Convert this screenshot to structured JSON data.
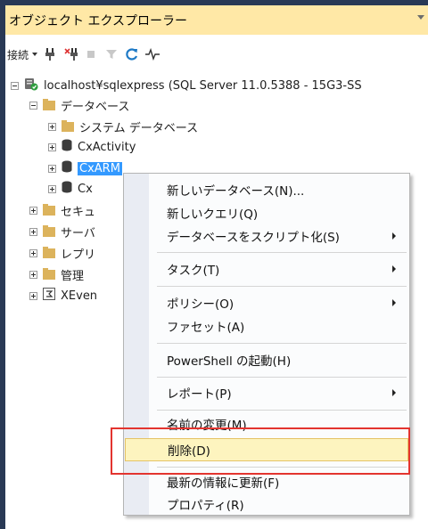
{
  "window": {
    "title": "オブジェクト エクスプローラー"
  },
  "toolbar": {
    "connect_label": "接続"
  },
  "tree": {
    "server": "localhost¥sqlexpress (SQL Server 11.0.5388 - 15G3-SS",
    "databases": "データベース",
    "system_databases": "システム データベース",
    "db1": "CxActivity",
    "db2_selected": "CxARM",
    "db3": "Cx",
    "security": "セキュ",
    "server_objects": "サーバ",
    "replication": "レプリ",
    "management": "管理",
    "xevent": "XEven"
  },
  "context_menu": {
    "items": [
      {
        "label": "新しいデータベース(N)..."
      },
      {
        "label": "新しいクエリ(Q)"
      },
      {
        "label": "データベースをスクリプト化(S)"
      },
      {
        "label": "タスク(T)"
      },
      {
        "label": "ポリシー(O)"
      },
      {
        "label": "ファセット(A)"
      },
      {
        "label": "PowerShell の起動(H)"
      },
      {
        "label": "レポート(P)"
      },
      {
        "label": "名前の変更(M)"
      },
      {
        "label": "削除(D)"
      },
      {
        "label": "最新の情報に更新(F)"
      },
      {
        "label": "プロパティ(R)"
      }
    ]
  },
  "colors": {
    "title_bar": "#ffe8a6",
    "selection": "#3399ff",
    "highlight_box": "#e3342f"
  }
}
